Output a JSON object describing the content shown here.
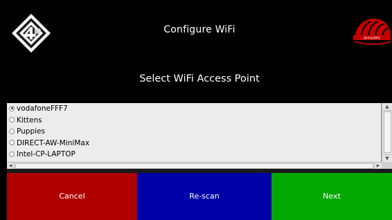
{
  "header": {
    "title": "Configure WiFi",
    "subtitle": "Select WiFi Access Point",
    "brand_text": "Armadillo"
  },
  "access_points": {
    "selected_index": 0,
    "items": [
      {
        "label": "vodafoneFFF7",
        "selected": true
      },
      {
        "label": "Kittens",
        "selected": false
      },
      {
        "label": "Puppies",
        "selected": false
      },
      {
        "label": "DIRECT-AW-MiniMax",
        "selected": false
      },
      {
        "label": "Intel-CP-LAPTOP",
        "selected": false
      }
    ]
  },
  "buttons": {
    "cancel": {
      "label": "Cancel",
      "color": "#b00000"
    },
    "rescan": {
      "label": "Re-scan",
      "color": "#0000a8"
    },
    "next": {
      "label": "Next",
      "color": "#00a800"
    }
  },
  "colors": {
    "background": "#000000",
    "list_background": "#ececec",
    "brand_red": "#c40000"
  },
  "icons": {
    "left_logo": "4p-logo-icon",
    "right_logo": "armadillo-logo-icon",
    "radio": "radio-icon",
    "scroll_up": "arrow-up-icon",
    "scroll_down": "arrow-down-icon",
    "scroll_left": "arrow-left-icon",
    "scroll_right": "arrow-right-icon"
  }
}
